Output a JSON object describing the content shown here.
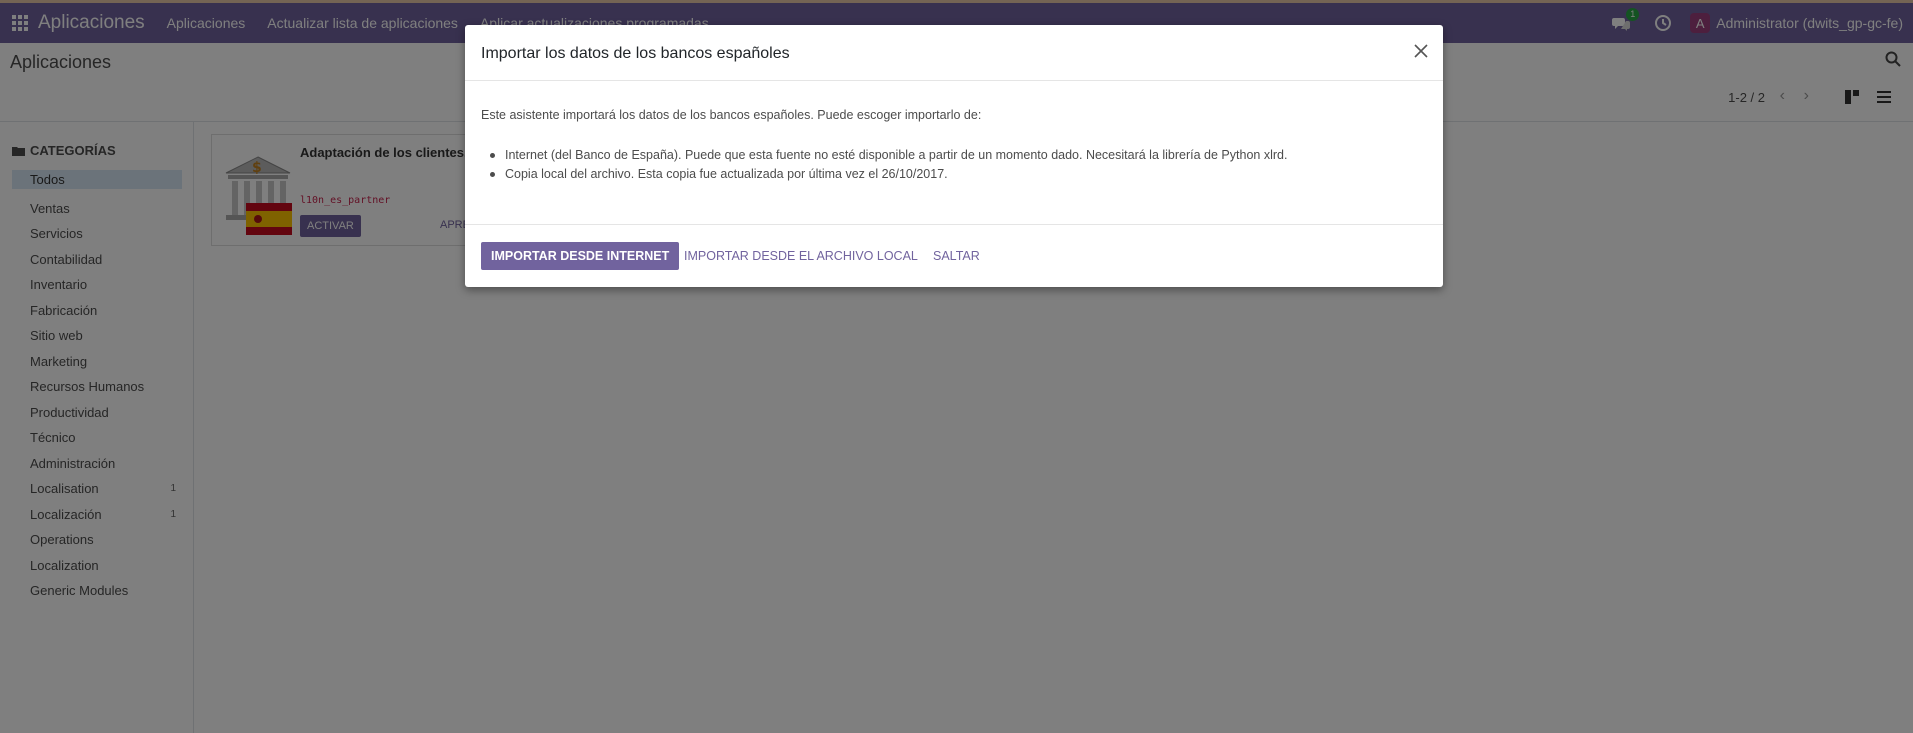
{
  "colors": {
    "primary": "#71639e",
    "sidebar_active": "#d7e7f4",
    "badge": "#28a745",
    "avatar": "#9b3e7c"
  },
  "navbar": {
    "brand": "Aplicaciones",
    "menu": [
      "Aplicaciones",
      "Actualizar lista de aplicaciones",
      "Aplicar actualizaciones programadas"
    ],
    "chat_badge": "1",
    "avatar_letter": "A",
    "user": "Administrator (dwits_gp-gc-fe)"
  },
  "control_panel": {
    "breadcrumb": "Aplicaciones",
    "pager": "1-2 / 2"
  },
  "sidebar": {
    "header": "CATEGORÍAS",
    "items": [
      {
        "label": "Todos",
        "count": ""
      },
      {
        "label": "Ventas",
        "count": ""
      },
      {
        "label": "Servicios",
        "count": ""
      },
      {
        "label": "Contabilidad",
        "count": ""
      },
      {
        "label": "Inventario",
        "count": ""
      },
      {
        "label": "Fabricación",
        "count": ""
      },
      {
        "label": "Sitio web",
        "count": ""
      },
      {
        "label": "Marketing",
        "count": ""
      },
      {
        "label": "Recursos Humanos",
        "count": ""
      },
      {
        "label": "Productividad",
        "count": ""
      },
      {
        "label": "Técnico",
        "count": ""
      },
      {
        "label": "Administración",
        "count": ""
      },
      {
        "label": "Localisation",
        "count": "1"
      },
      {
        "label": "Localización",
        "count": "1"
      },
      {
        "label": "Operations",
        "count": ""
      },
      {
        "label": "Localization",
        "count": ""
      },
      {
        "label": "Generic Modules",
        "count": ""
      }
    ]
  },
  "card": {
    "title": "Adaptación de los clientes, p",
    "technical_name": "l10n_es_partner",
    "activate_label": "ACTIVAR",
    "learn_label": "APRE"
  },
  "modal": {
    "title": "Importar los datos de los bancos españoles",
    "intro": "Este asistente importará los datos de los bancos españoles. Puede escoger importarlo de:",
    "options": [
      "Internet (del Banco de España). Puede que esta fuente no esté disponible a partir de un momento dado. Necesitará la librería de Python xlrd.",
      "Copia local del archivo. Esta copia fue actualizada por última vez el 26/10/2017."
    ],
    "btn_internet": "IMPORTAR DESDE INTERNET",
    "btn_local": "IMPORTAR DESDE EL ARCHIVO LOCAL",
    "btn_skip": "SALTAR"
  }
}
